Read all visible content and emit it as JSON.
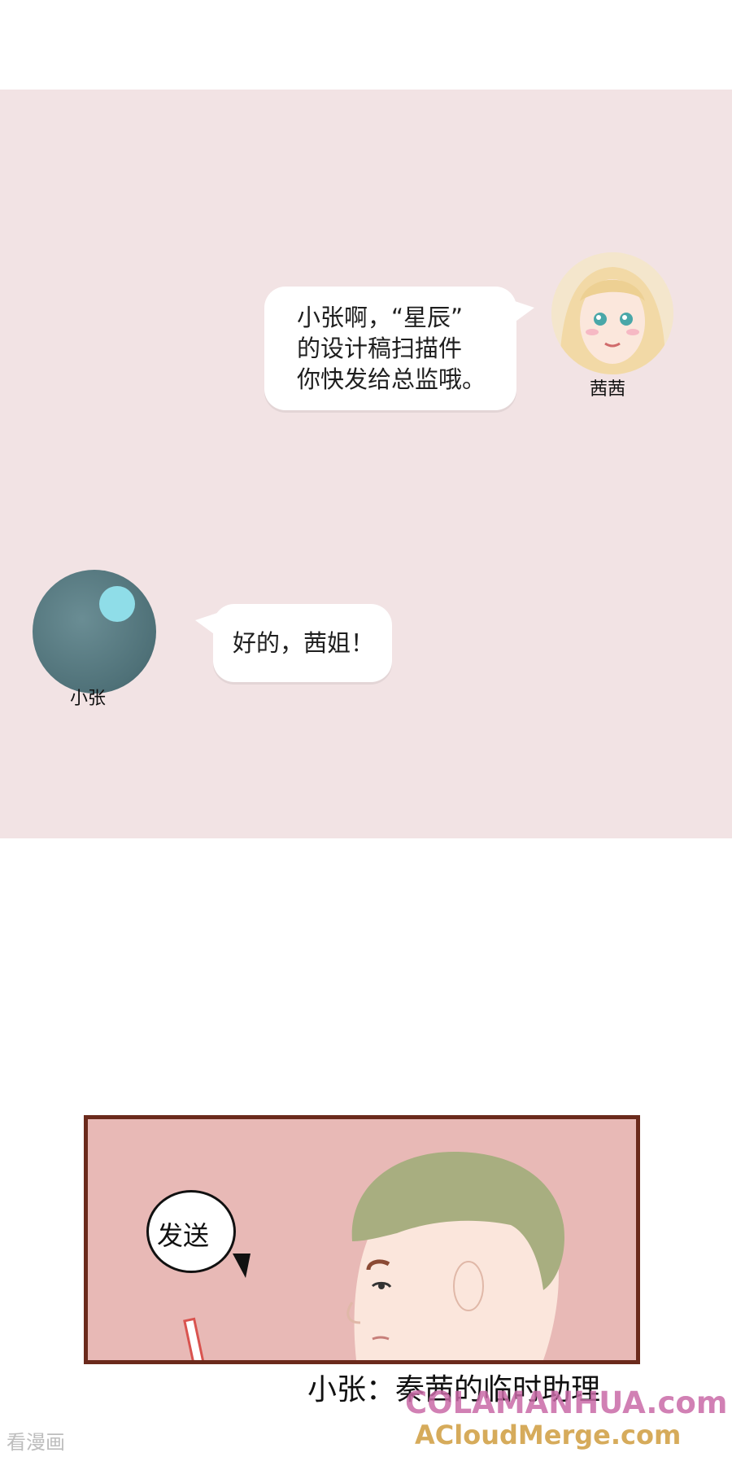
{
  "chat": {
    "message_1": {
      "sender": "茜茜",
      "lines": [
        "小张啊，“星辰”",
        "的设计稿扫描件",
        "你快发给总监哦。"
      ]
    },
    "message_2": {
      "sender": "小张",
      "text": "好的，茜姐！"
    }
  },
  "scene": {
    "speech": "发送",
    "caption": "小张：秦茜的临时助理"
  },
  "watermarks": {
    "primary": "COLAMANHUA.com",
    "secondary": "ACloudMerge.com",
    "corner": "看漫画"
  },
  "colors": {
    "chat_background": "#f2e3e4",
    "frame_border": "#6b2a1c",
    "avatar_zhang": "#4f7178",
    "avatar_zhang_highlight": "#8fdde8"
  }
}
